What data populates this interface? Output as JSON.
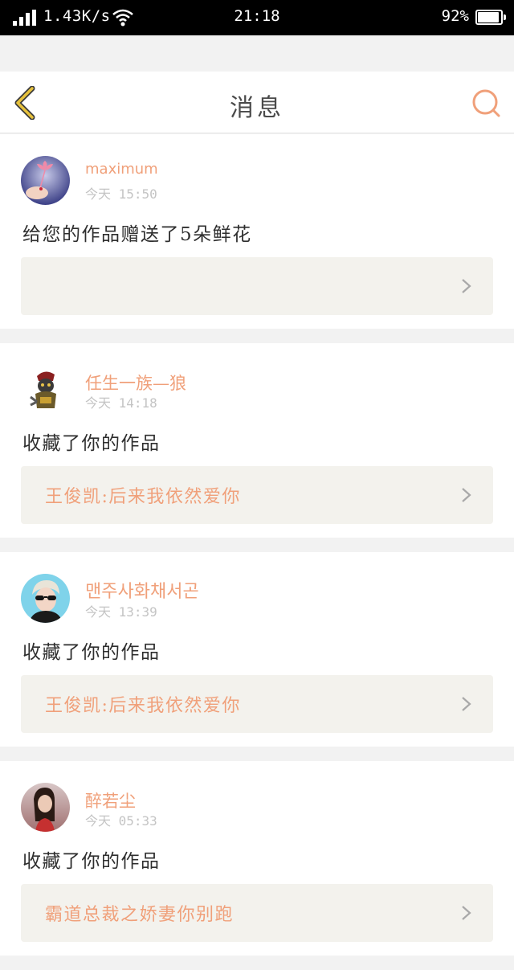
{
  "status_bar": {
    "network_speed": "1.43K/s",
    "time": "21:18",
    "battery_percent": "92%",
    "battery_level": 0.92
  },
  "header": {
    "title": "消息",
    "back_icon": "chevron-left-icon",
    "search_icon": "search-icon"
  },
  "colors": {
    "accent": "#f0a07a",
    "back_icon": "#e7c23c",
    "work_box_bg": "#f3f2ed"
  },
  "messages": [
    {
      "username": "maximum",
      "time": "今天 15:50",
      "text": "给您的作品赠送了5朵鲜花",
      "work_title": ""
    },
    {
      "username": "任生一族—狼",
      "time": "今天 14:18",
      "text": "收藏了你的作品",
      "work_title": "王俊凯:后来我依然爱你"
    },
    {
      "username": "맨주사화채서곤",
      "time": "今天 13:39",
      "text": "收藏了你的作品",
      "work_title": "王俊凯:后来我依然爱你"
    },
    {
      "username": "醉若尘",
      "time": "今天 05:33",
      "text": "收藏了你的作品",
      "work_title": "霸道总裁之娇妻你别跑"
    }
  ]
}
